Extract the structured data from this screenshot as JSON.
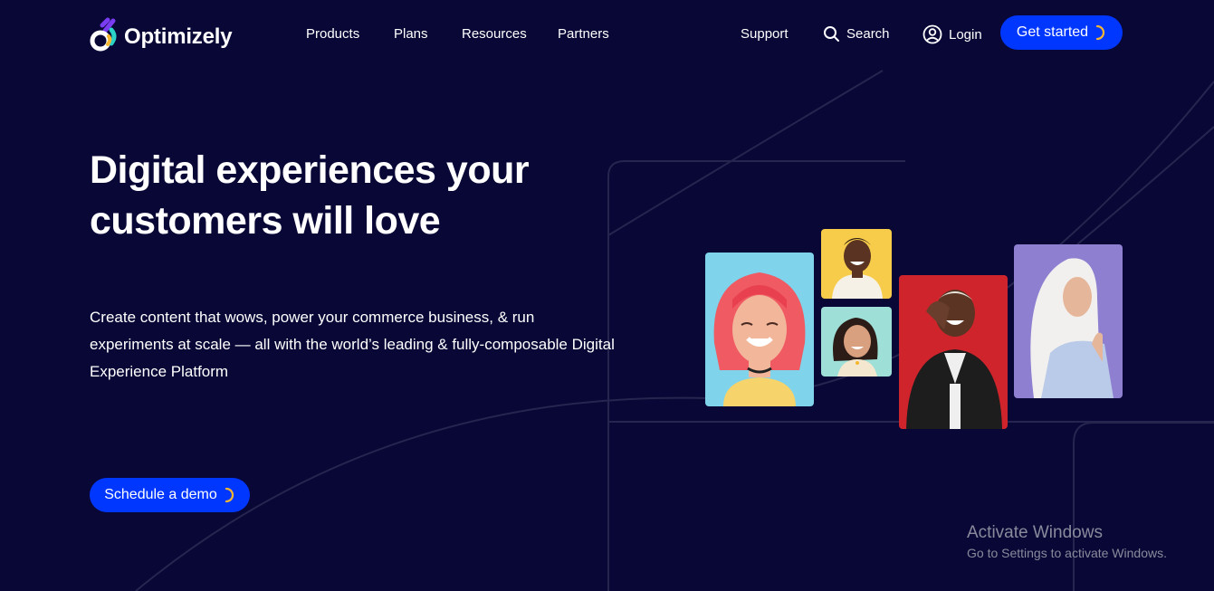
{
  "brand": {
    "name": "Optimizely"
  },
  "nav": {
    "items": [
      {
        "label": "Products"
      },
      {
        "label": "Plans"
      },
      {
        "label": "Resources"
      },
      {
        "label": "Partners"
      }
    ],
    "support_label": "Support",
    "search_label": "Search",
    "login_label": "Login",
    "cta_label": "Get started"
  },
  "hero": {
    "title_line1": "Digital experiences your",
    "title_line2": "customers will love",
    "subtitle": "Create content that wows, power your commerce business, & run experiments at scale — all with the world’s leading & fully-composable Digital Experience Platform",
    "cta_label": "Schedule a demo"
  },
  "watermark": {
    "title": "Activate Windows",
    "subtitle": "Go to Settings to activate Windows."
  },
  "colors": {
    "background": "#080736",
    "primary_button": "#0037ff",
    "spinner_accent": "#f5b731",
    "logo_purple": "#7a3cf0",
    "logo_yellow": "#f5b731",
    "logo_teal": "#2bd3c7"
  },
  "icons": [
    "search-icon",
    "user-circle-icon",
    "loading-spinner-icon"
  ]
}
